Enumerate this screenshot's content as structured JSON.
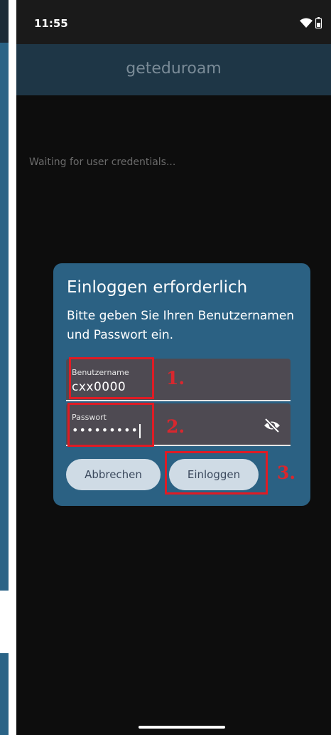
{
  "status_bar": {
    "time": "11:55",
    "wifi_icon": "wifi-icon",
    "battery_icon": "battery-icon"
  },
  "app_bar": {
    "title": "geteduroam"
  },
  "main": {
    "status_text": "Waiting for user credentials..."
  },
  "dialog": {
    "title": "Einloggen erforderlich",
    "message": "Bitte geben Sie Ihren Benutzernamen und Passwort ein.",
    "username": {
      "label": "Benutzername",
      "value": "cxx0000"
    },
    "password": {
      "label": "Passwort",
      "value": "•••••••••",
      "toggle_icon": "eye-off-icon"
    },
    "cancel_label": "Abbrechen",
    "login_label": "Einloggen"
  },
  "annotations": {
    "step1": "1.",
    "step2": "2.",
    "step3": "3."
  },
  "colors": {
    "background": "#0d0d0d",
    "app_bar": "#1e3646",
    "dialog": "#2b6183",
    "field": "#4e4a52",
    "button": "#cfdbe5",
    "annotation_red": "#e01b24"
  }
}
